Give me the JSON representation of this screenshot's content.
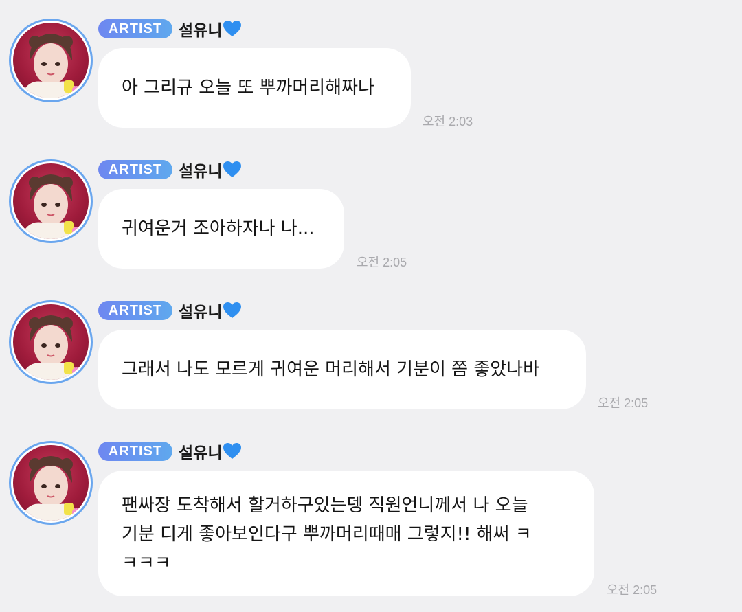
{
  "messages": [
    {
      "badge": "ARTIST",
      "sender": "설유니",
      "text": "아 그리규 오늘 또 뿌까머리해짜나",
      "time": "오전 2:03"
    },
    {
      "badge": "ARTIST",
      "sender": "설유니",
      "text": "귀여운거 조아하자나 나...",
      "time": "오전 2:05"
    },
    {
      "badge": "ARTIST",
      "sender": "설유니",
      "text": "그래서 나도 모르게 귀여운 머리해서 기분이 쫌 좋았나바",
      "time": "오전 2:05"
    },
    {
      "badge": "ARTIST",
      "sender": "설유니",
      "text_lines": [
        "팬싸장 도착해서 할거하구있는뎅 직원언니께서 나 오늘",
        "기분 디게 좋아보인다구 뿌까머리때매 그렇지!! 해써 ㅋ",
        "ㅋㅋㅋ"
      ],
      "time": "오전 2:05"
    }
  ],
  "colors": {
    "background": "#f0f0f2",
    "bubble": "#ffffff",
    "badge_start": "#6e87f0",
    "badge_end": "#5fa8ee",
    "avatar_ring": "#6aa6ee",
    "heart": "#2f8ff0",
    "time_text": "#a9a9ad"
  },
  "icons": {
    "heart": "blue-heart-icon"
  }
}
